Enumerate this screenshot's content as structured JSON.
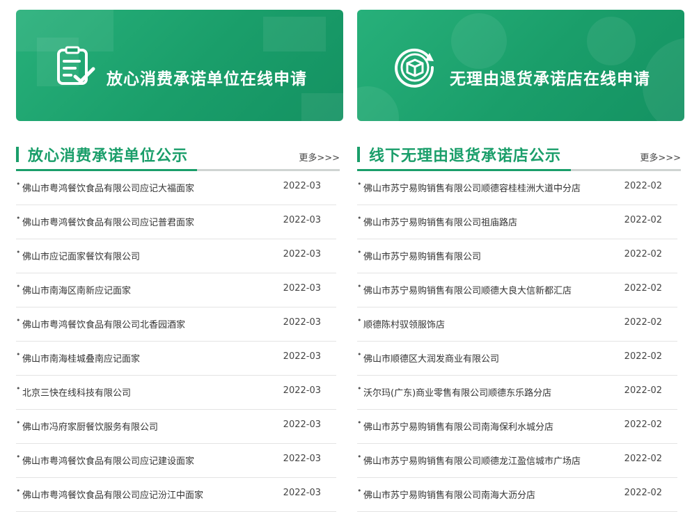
{
  "banners": {
    "left": {
      "title": "放心消费承诺单位在线申请",
      "icon": "checklist-document-icon"
    },
    "right": {
      "title": "无理由退货承诺店在线申请",
      "icon": "return-box-icon"
    }
  },
  "left_panel": {
    "title": "放心消费承诺单位公示",
    "more": "更多>>>",
    "items": [
      {
        "name": "佛山市粤鸿餐饮食品有限公司应记大福面家",
        "date": "2022-03"
      },
      {
        "name": "佛山市粤鸿餐饮食品有限公司应记普君面家",
        "date": "2022-03"
      },
      {
        "name": "佛山市应记面家餐饮有限公司",
        "date": "2022-03"
      },
      {
        "name": "佛山市南海区南新应记面家",
        "date": "2022-03"
      },
      {
        "name": "佛山市粤鸿餐饮食品有限公司北香园酒家",
        "date": "2022-03"
      },
      {
        "name": "佛山市南海桂城叠南应记面家",
        "date": "2022-03"
      },
      {
        "name": "北京三快在线科技有限公司",
        "date": "2022-03"
      },
      {
        "name": "佛山市冯府家厨餐饮服务有限公司",
        "date": "2022-03"
      },
      {
        "name": "佛山市粤鸿餐饮食品有限公司应记建设面家",
        "date": "2022-03"
      },
      {
        "name": "佛山市粤鸿餐饮食品有限公司应记汾江中面家",
        "date": "2022-03"
      }
    ]
  },
  "right_panel": {
    "title": "线下无理由退货承诺店公示",
    "more": "更多>>>",
    "items": [
      {
        "name": "佛山市苏宁易购销售有限公司顺德容桂桂洲大道中分店",
        "date": "2022-02"
      },
      {
        "name": "佛山市苏宁易购销售有限公司祖庙路店",
        "date": "2022-02"
      },
      {
        "name": "佛山市苏宁易购销售有限公司",
        "date": "2022-02"
      },
      {
        "name": "佛山市苏宁易购销售有限公司顺德大良大信新都汇店",
        "date": "2022-02"
      },
      {
        "name": "顺德陈村驭领服饰店",
        "date": "2022-02"
      },
      {
        "name": "佛山市顺德区大润发商业有限公司",
        "date": "2022-02"
      },
      {
        "name": "沃尔玛(广东)商业零售有限公司顺德东乐路分店",
        "date": "2022-02"
      },
      {
        "name": "佛山市苏宁易购销售有限公司南海保利水城分店",
        "date": "2022-02"
      },
      {
        "name": "佛山市苏宁易购销售有限公司顺德龙江盈信城市广场店",
        "date": "2022-02"
      },
      {
        "name": "佛山市苏宁易购销售有限公司南海大沥分店",
        "date": "2022-02"
      }
    ]
  },
  "colors": {
    "brand_green": "#1a9e6a"
  }
}
